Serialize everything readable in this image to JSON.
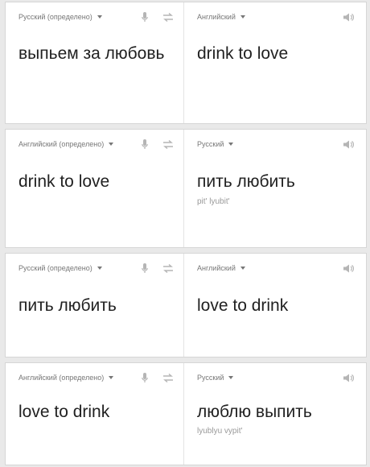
{
  "cards": [
    {
      "source": {
        "lang": "Русский (определено)",
        "text": "выпьем за любовь"
      },
      "target": {
        "lang": "Английский",
        "text": "drink to love",
        "translit": ""
      }
    },
    {
      "source": {
        "lang": "Английский (определено)",
        "text": "drink to love"
      },
      "target": {
        "lang": "Русский",
        "text": "пить любить",
        "translit": "pit' lyubit'"
      }
    },
    {
      "source": {
        "lang": "Русский (определено)",
        "text": "пить любить"
      },
      "target": {
        "lang": "Английский",
        "text": "love to drink",
        "translit": ""
      }
    },
    {
      "source": {
        "lang": "Английский (определено)",
        "text": "love to drink"
      },
      "target": {
        "lang": "Русский",
        "text": "люблю выпить",
        "translit": "lyublyu vypit'"
      }
    }
  ],
  "icons": {
    "mic": "microphone-icon",
    "swap": "swap-languages-icon",
    "speaker": "speaker-icon"
  },
  "colors": {
    "background": "#e9e9e9",
    "card": "#ffffff",
    "text": "#212121",
    "muted": "#777777"
  }
}
